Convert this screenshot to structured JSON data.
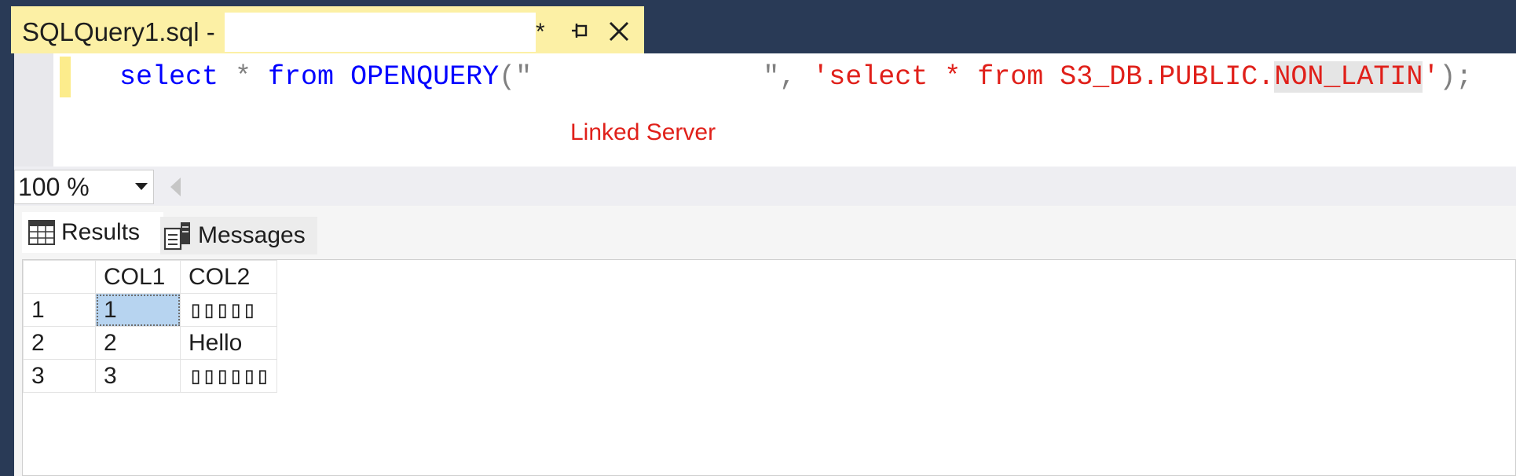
{
  "window": {
    "tab": {
      "title": "SQLQuery1.sql -",
      "modified_marker": "*"
    }
  },
  "editor": {
    "code": {
      "kw_select": "select",
      "star1": " * ",
      "kw_from": "from",
      "fn": " OPENQUERY",
      "open": "(\"",
      "gap": "              ",
      "close_quote": "\", ",
      "str_part1": "'select * from S3_DB.PUBLIC.",
      "str_highlight": "NON_LATIN",
      "str_part2": "'",
      "end": ");"
    },
    "overlay_label": "Linked Server"
  },
  "zoom": {
    "value": "100 %"
  },
  "results": {
    "tabs": {
      "results_label": "Results",
      "messages_label": "Messages"
    },
    "columns": [
      "",
      "COL1",
      "COL2"
    ],
    "rows": [
      {
        "row": "1",
        "col1": "1",
        "col2": "▯▯▯▯▯"
      },
      {
        "row": "2",
        "col1": "2",
        "col2": "Hello"
      },
      {
        "row": "3",
        "col1": "3",
        "col2": "▯▯▯▯▯▯"
      }
    ]
  },
  "colors": {
    "keyword": "#0000ff",
    "string": "#e0201a",
    "tab_active": "#fcf0a5",
    "chrome": "#293a56",
    "selection": "#b7d4f0"
  }
}
